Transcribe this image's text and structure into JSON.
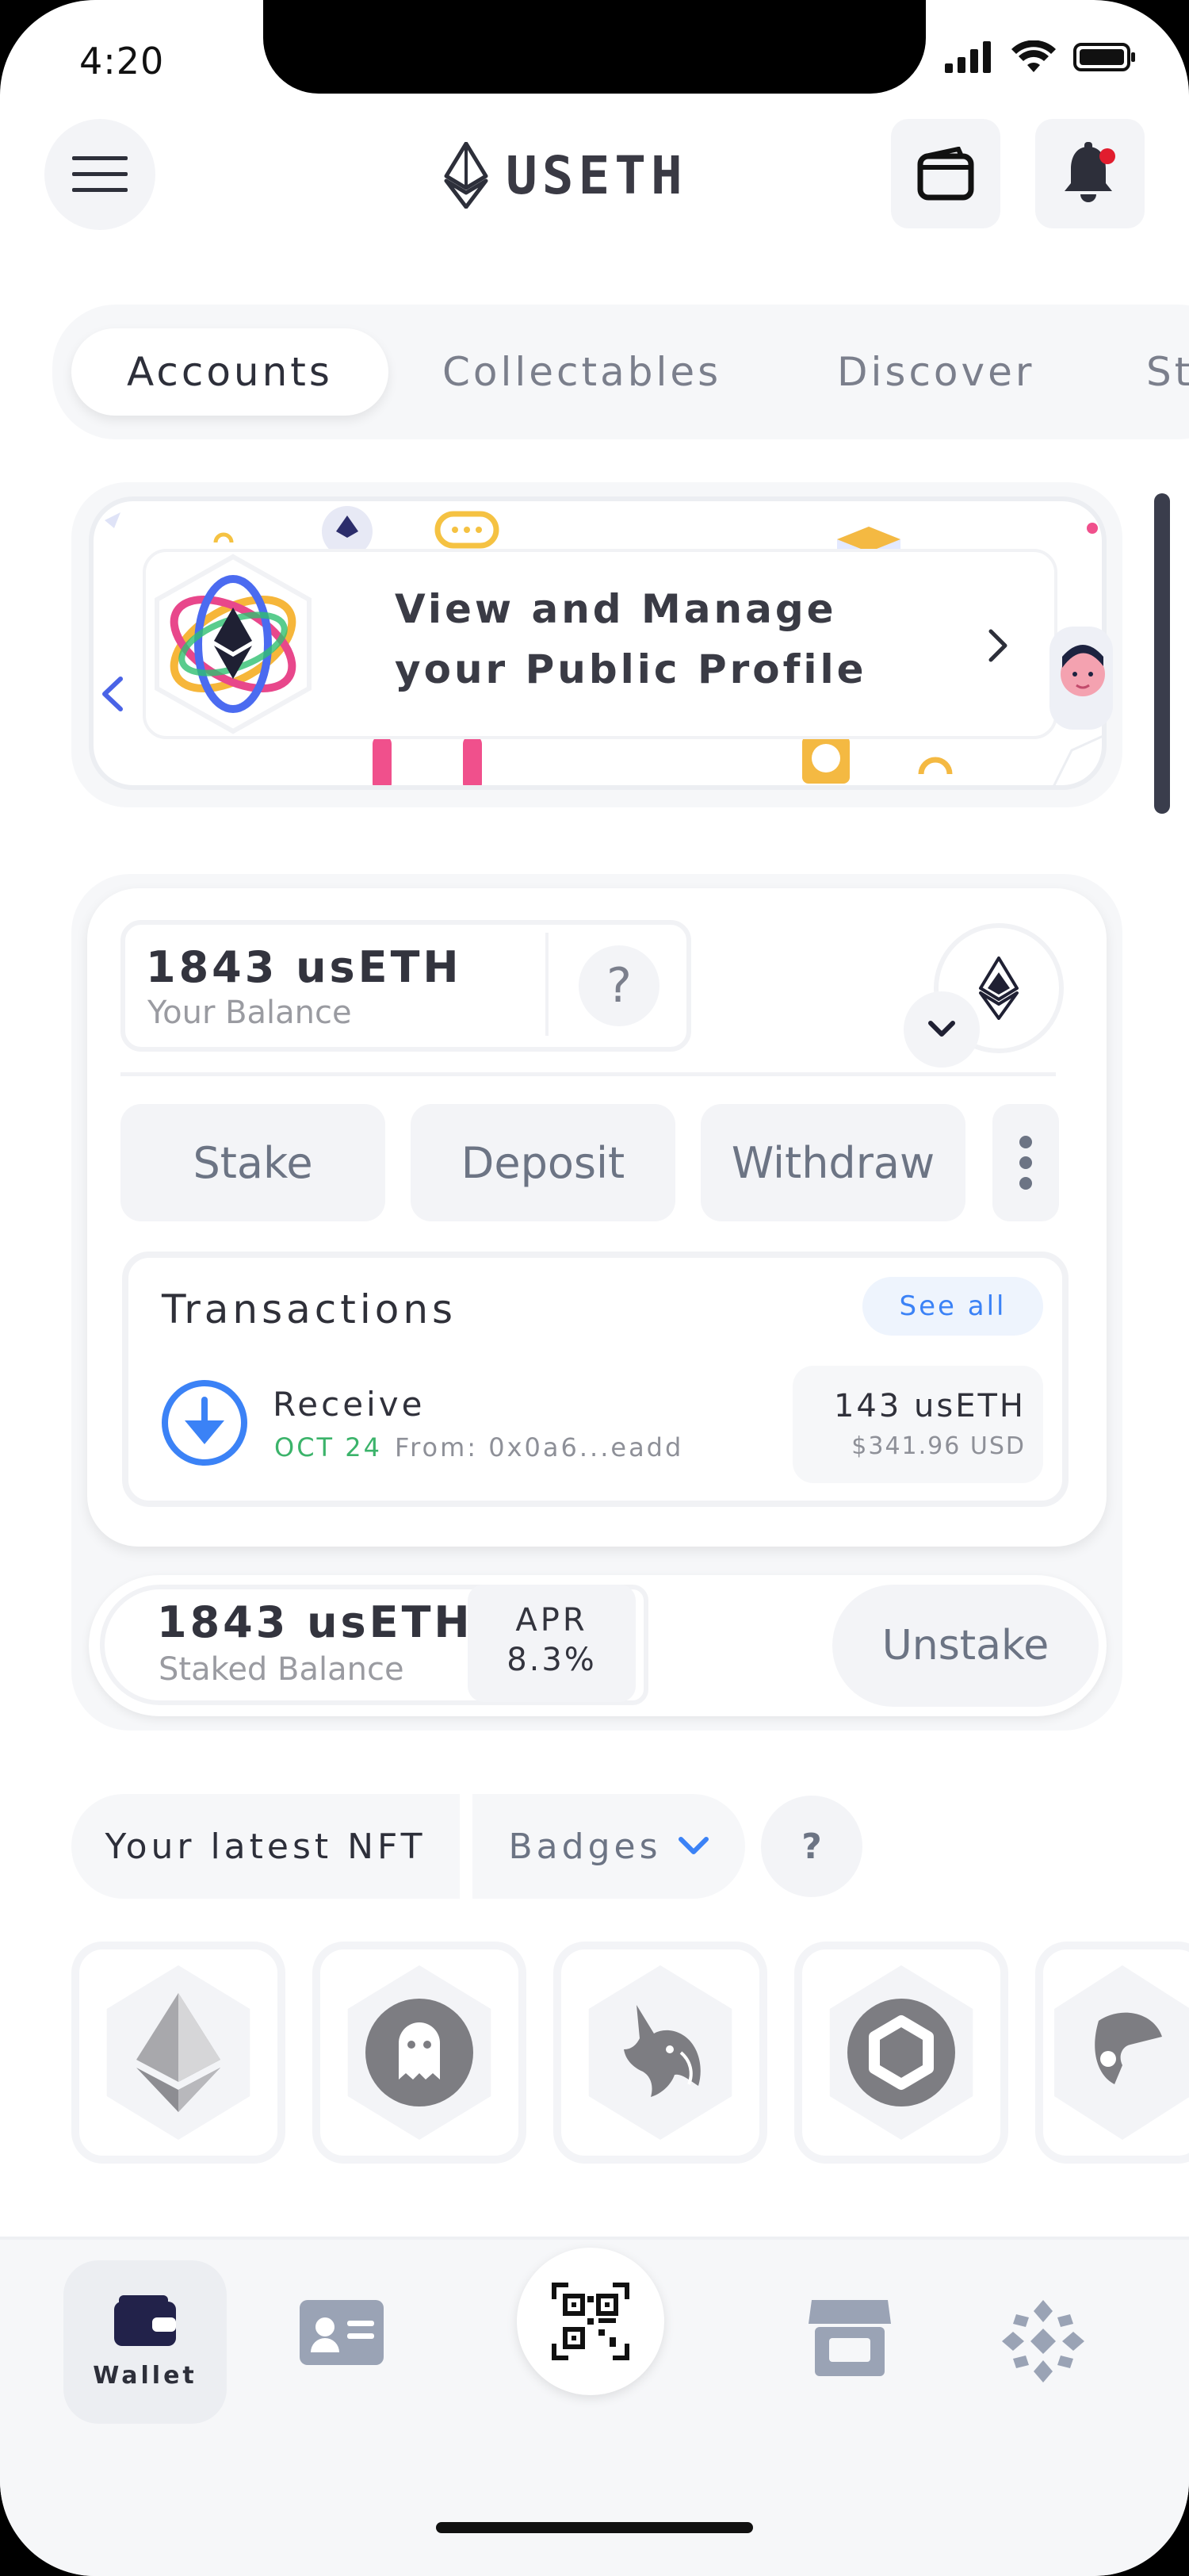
{
  "status_bar": {
    "time": "4:20"
  },
  "header": {
    "logo_text": "USETH"
  },
  "tabs": [
    {
      "label": "Accounts",
      "active": true
    },
    {
      "label": "Collectables",
      "active": false
    },
    {
      "label": "Discover",
      "active": false
    },
    {
      "label": "St",
      "active": false
    }
  ],
  "profile_banner": {
    "line1": "View and Manage",
    "line2": "your Public Profile"
  },
  "balance": {
    "amount": "1843 usETH",
    "label": "Your Balance",
    "help": "?"
  },
  "actions": {
    "stake": "Stake",
    "deposit": "Deposit",
    "withdraw": "Withdraw"
  },
  "transactions": {
    "title": "Transactions",
    "see_all": "See all",
    "items": [
      {
        "type": "Receive",
        "date": "OCT 24",
        "from": "From: 0x0a6...eadd",
        "amount": "143 usETH",
        "usd": "$341.96 USD"
      }
    ]
  },
  "staked": {
    "amount": "1843 usETH",
    "label": "Staked Balance",
    "apr_label": "APR",
    "apr_value": "8.3%",
    "unstake": "Unstake"
  },
  "nft": {
    "latest_label": "Your latest NFT",
    "filter": "Badges",
    "help": "?",
    "items": [
      "ethereum-icon",
      "ghost-icon",
      "unicorn-icon",
      "chainlink-icon",
      "partial-icon"
    ]
  },
  "bottom_nav": {
    "wallet_label": "Wallet"
  },
  "colors": {
    "accent_blue": "#3b82f6",
    "date_green": "#3bb36a",
    "notification_red": "#e11d2e"
  }
}
